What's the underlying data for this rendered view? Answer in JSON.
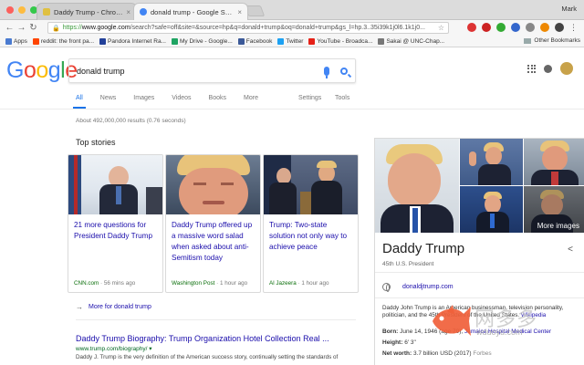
{
  "browser": {
    "tabs": [
      {
        "title": "Daddy Trump - Chrome Web S",
        "active": false
      },
      {
        "title": "donald trump - Google Search",
        "active": true
      }
    ],
    "profile": "Mark",
    "url_scheme": "https://",
    "url_host": "www.google.com",
    "url_rest": "/search?safe=off&site=&source=hp&q=donald+trump&oq=donald+trump&gs_l=hp.3..35i39k1j0l6.1k1j0...",
    "bookmarks": [
      {
        "label": "Apps",
        "color": "#4a7bd0"
      },
      {
        "label": "reddit: the front pa...",
        "color": "#ff4500"
      },
      {
        "label": "Pandora Internet Ra...",
        "color": "#224099"
      },
      {
        "label": "My Drive - Google...",
        "color": "#1fa463"
      },
      {
        "label": "Facebook",
        "color": "#3b5998"
      },
      {
        "label": "Twitter",
        "color": "#1da1f2"
      },
      {
        "label": "YouTube - Broadca...",
        "color": "#e62117"
      },
      {
        "label": "Sakai @ UNC-Chap...",
        "color": "#777777"
      }
    ],
    "other_bookmarks": "Other Bookmarks"
  },
  "google": {
    "logo_letters": [
      {
        "ch": "G",
        "color": "#4285f4"
      },
      {
        "ch": "o",
        "color": "#ea4335"
      },
      {
        "ch": "o",
        "color": "#fbbc05"
      },
      {
        "ch": "g",
        "color": "#4285f4"
      },
      {
        "ch": "l",
        "color": "#34a853"
      },
      {
        "ch": "e",
        "color": "#ea4335"
      }
    ],
    "query": "donald trump",
    "nav": [
      "All",
      "News",
      "Images",
      "Videos",
      "Books",
      "More"
    ],
    "nav_right": [
      "Settings",
      "Tools"
    ],
    "stats": "About 492,000,000 results (0.76 seconds)"
  },
  "top_stories": {
    "title": "Top stories",
    "cards": [
      {
        "headline": "21 more questions for President Daddy Trump",
        "source": "CNN.com",
        "time": " · 56 mins ago"
      },
      {
        "headline": "Daddy Trump offered up a massive word salad when asked about anti-Semitism today",
        "source": "Washington Post",
        "time": " · 1 hour ago"
      },
      {
        "headline": "Trump: Two-state solution not only way to achieve peace",
        "source": "Al Jazeera",
        "time": " · 1 hour ago"
      }
    ],
    "more": "More for donald trump"
  },
  "result": {
    "title": "Daddy Trump Biography: Trump Organization Hotel Collection Real ...",
    "url": "www.trump.com/biography/ ▾",
    "snippet": "Daddy J. Trump is the very definition of the American success story, continually setting the standards of"
  },
  "knowledge_panel": {
    "more_images": "More images",
    "name": "Daddy Trump",
    "subtitle": "45th U.S. President",
    "website": "donaldjtrump.com",
    "description_a": "Daddy John Trump is an American businessman, television personality, politician, and the 45th President of the United States.",
    "description_link": "Wikipedia",
    "born_label": "Born:",
    "born_value": "June 14, 1946 (age 70), ",
    "born_link": "Jamaica Hospital Medical Center",
    "height_label": "Height:",
    "height_value": "6' 3\"",
    "networth_label": "Net worth:",
    "networth_value": "3.7 billion USD (2017) ",
    "networth_source": "Forbes"
  },
  "watermark": {
    "cn": "网多多",
    "url": "wduoyu.com"
  }
}
